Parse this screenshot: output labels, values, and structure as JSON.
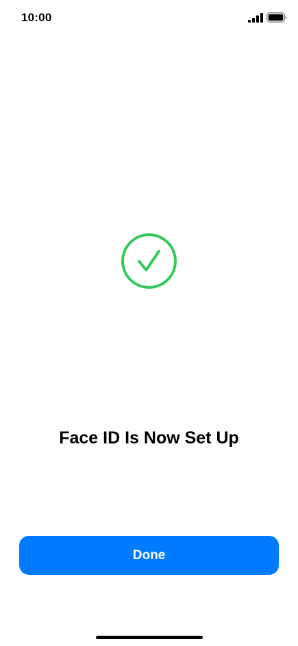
{
  "status_bar": {
    "time": "10:00",
    "signal_icon": "cellular-signal-icon",
    "battery_icon": "battery-icon"
  },
  "main": {
    "status_icon": "checkmark-circle-icon",
    "title": "Face ID Is Now Set Up"
  },
  "actions": {
    "done_label": "Done"
  },
  "colors": {
    "accent": "#007aff",
    "success": "#34c759",
    "text": "#000000",
    "background": "#ffffff"
  }
}
